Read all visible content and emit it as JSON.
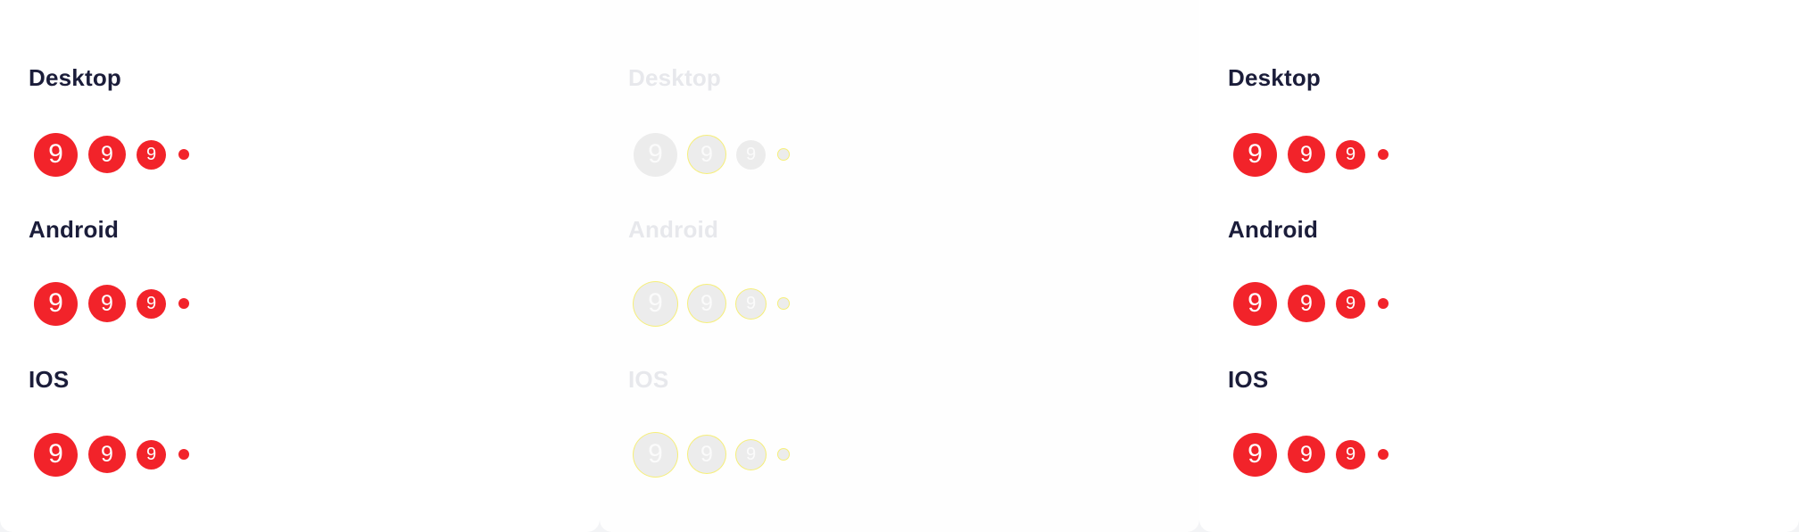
{
  "panels": [
    {
      "sections": [
        {
          "title": "Desktop",
          "badges": [
            "9",
            "9",
            "9"
          ]
        },
        {
          "title": "Android",
          "badges": [
            "9",
            "9",
            "9"
          ]
        },
        {
          "title": "IOS",
          "badges": [
            "9",
            "9",
            "9"
          ]
        }
      ]
    },
    {
      "sections": [
        {
          "title": "Desktop",
          "badges": [
            "9",
            "9",
            "9"
          ]
        },
        {
          "title": "Android",
          "badges": [
            "9",
            "9",
            "9"
          ]
        },
        {
          "title": "IOS",
          "badges": [
            "9",
            "9",
            "9"
          ]
        }
      ]
    },
    {
      "sections": [
        {
          "title": "Desktop",
          "badges": [
            "9",
            "9",
            "9"
          ]
        },
        {
          "title": "Android",
          "badges": [
            "9",
            "9",
            "9"
          ]
        },
        {
          "title": "IOS",
          "badges": [
            "9",
            "9",
            "9"
          ]
        }
      ]
    }
  ],
  "colors": {
    "badge_red": "#f2232a",
    "title_dark": "#1b1d3a",
    "disabled_gray": "#ececec",
    "highlight_yellow": "#f6ef7a"
  }
}
